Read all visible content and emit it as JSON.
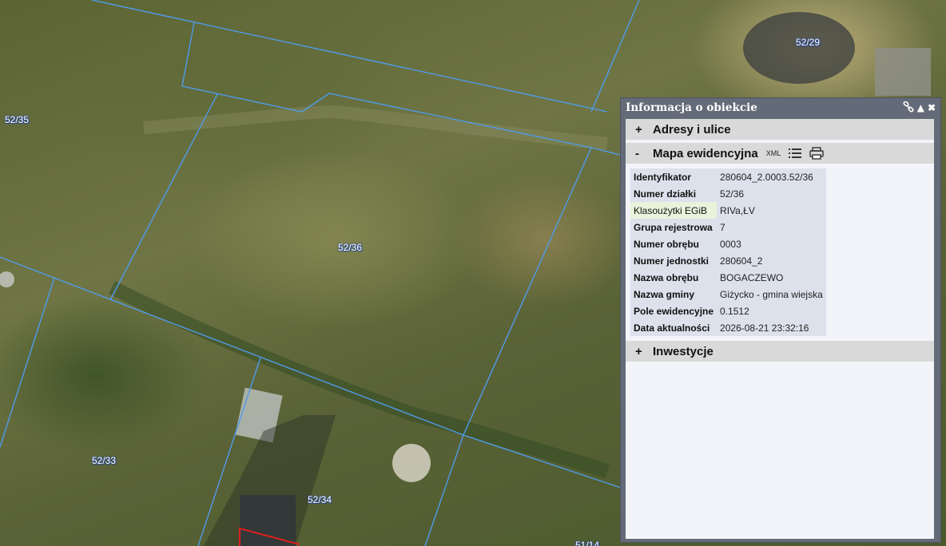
{
  "map": {
    "parcels": [
      {
        "label": "52/29"
      },
      {
        "label": "52/35"
      },
      {
        "label": "52/36"
      },
      {
        "label": "52/33"
      },
      {
        "label": "52/34"
      },
      {
        "label": "51/14"
      }
    ],
    "colors": {
      "boundary": "#4f9bea",
      "highlight": "#e01e1e"
    }
  },
  "panel": {
    "title": "Informacja o obiekcie",
    "icons": [
      "link-icon",
      "collapse-up-icon",
      "close-icon"
    ],
    "sections": {
      "addresses": {
        "toggle": "+",
        "label": "Adresy i ulice"
      },
      "cadastral": {
        "toggle": "-",
        "label": "Mapa ewidencyjna",
        "xml_label": "XML"
      },
      "investments": {
        "toggle": "+",
        "label": "Inwestycje"
      }
    },
    "attributes": [
      {
        "key": "Identyfikator",
        "value": "280604_2.0003.52/36"
      },
      {
        "key": "Numer działki",
        "value": "52/36"
      },
      {
        "key": "Klasoużytki EGiB",
        "value": "RIVa,ŁV"
      },
      {
        "key": "Grupa rejestrowa",
        "value": "7"
      },
      {
        "key": "Numer obrębu",
        "value": "0003"
      },
      {
        "key": "Numer jednostki",
        "value": "280604_2"
      },
      {
        "key": "Nazwa obrębu",
        "value": "BOGACZEWO"
      },
      {
        "key": "Nazwa gminy",
        "value": "Giżycko - gmina wiejska"
      },
      {
        "key": "Pole ewidencyjne",
        "value": "0.1512"
      },
      {
        "key": "Data aktualności",
        "value": "2026-08-21 23:32:16"
      }
    ]
  }
}
